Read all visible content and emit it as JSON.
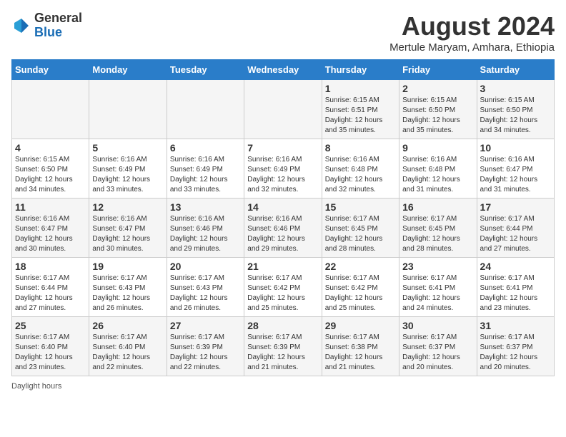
{
  "header": {
    "logo_general": "General",
    "logo_blue": "Blue",
    "month_year": "August 2024",
    "location": "Mertule Maryam, Amhara, Ethiopia"
  },
  "days_of_week": [
    "Sunday",
    "Monday",
    "Tuesday",
    "Wednesday",
    "Thursday",
    "Friday",
    "Saturday"
  ],
  "weeks": [
    [
      {
        "day": "",
        "info": ""
      },
      {
        "day": "",
        "info": ""
      },
      {
        "day": "",
        "info": ""
      },
      {
        "day": "",
        "info": ""
      },
      {
        "day": "1",
        "info": "Sunrise: 6:15 AM\nSunset: 6:51 PM\nDaylight: 12 hours\nand 35 minutes."
      },
      {
        "day": "2",
        "info": "Sunrise: 6:15 AM\nSunset: 6:50 PM\nDaylight: 12 hours\nand 35 minutes."
      },
      {
        "day": "3",
        "info": "Sunrise: 6:15 AM\nSunset: 6:50 PM\nDaylight: 12 hours\nand 34 minutes."
      }
    ],
    [
      {
        "day": "4",
        "info": "Sunrise: 6:15 AM\nSunset: 6:50 PM\nDaylight: 12 hours\nand 34 minutes."
      },
      {
        "day": "5",
        "info": "Sunrise: 6:16 AM\nSunset: 6:49 PM\nDaylight: 12 hours\nand 33 minutes."
      },
      {
        "day": "6",
        "info": "Sunrise: 6:16 AM\nSunset: 6:49 PM\nDaylight: 12 hours\nand 33 minutes."
      },
      {
        "day": "7",
        "info": "Sunrise: 6:16 AM\nSunset: 6:49 PM\nDaylight: 12 hours\nand 32 minutes."
      },
      {
        "day": "8",
        "info": "Sunrise: 6:16 AM\nSunset: 6:48 PM\nDaylight: 12 hours\nand 32 minutes."
      },
      {
        "day": "9",
        "info": "Sunrise: 6:16 AM\nSunset: 6:48 PM\nDaylight: 12 hours\nand 31 minutes."
      },
      {
        "day": "10",
        "info": "Sunrise: 6:16 AM\nSunset: 6:47 PM\nDaylight: 12 hours\nand 31 minutes."
      }
    ],
    [
      {
        "day": "11",
        "info": "Sunrise: 6:16 AM\nSunset: 6:47 PM\nDaylight: 12 hours\nand 30 minutes."
      },
      {
        "day": "12",
        "info": "Sunrise: 6:16 AM\nSunset: 6:47 PM\nDaylight: 12 hours\nand 30 minutes."
      },
      {
        "day": "13",
        "info": "Sunrise: 6:16 AM\nSunset: 6:46 PM\nDaylight: 12 hours\nand 29 minutes."
      },
      {
        "day": "14",
        "info": "Sunrise: 6:16 AM\nSunset: 6:46 PM\nDaylight: 12 hours\nand 29 minutes."
      },
      {
        "day": "15",
        "info": "Sunrise: 6:17 AM\nSunset: 6:45 PM\nDaylight: 12 hours\nand 28 minutes."
      },
      {
        "day": "16",
        "info": "Sunrise: 6:17 AM\nSunset: 6:45 PM\nDaylight: 12 hours\nand 28 minutes."
      },
      {
        "day": "17",
        "info": "Sunrise: 6:17 AM\nSunset: 6:44 PM\nDaylight: 12 hours\nand 27 minutes."
      }
    ],
    [
      {
        "day": "18",
        "info": "Sunrise: 6:17 AM\nSunset: 6:44 PM\nDaylight: 12 hours\nand 27 minutes."
      },
      {
        "day": "19",
        "info": "Sunrise: 6:17 AM\nSunset: 6:43 PM\nDaylight: 12 hours\nand 26 minutes."
      },
      {
        "day": "20",
        "info": "Sunrise: 6:17 AM\nSunset: 6:43 PM\nDaylight: 12 hours\nand 26 minutes."
      },
      {
        "day": "21",
        "info": "Sunrise: 6:17 AM\nSunset: 6:42 PM\nDaylight: 12 hours\nand 25 minutes."
      },
      {
        "day": "22",
        "info": "Sunrise: 6:17 AM\nSunset: 6:42 PM\nDaylight: 12 hours\nand 25 minutes."
      },
      {
        "day": "23",
        "info": "Sunrise: 6:17 AM\nSunset: 6:41 PM\nDaylight: 12 hours\nand 24 minutes."
      },
      {
        "day": "24",
        "info": "Sunrise: 6:17 AM\nSunset: 6:41 PM\nDaylight: 12 hours\nand 23 minutes."
      }
    ],
    [
      {
        "day": "25",
        "info": "Sunrise: 6:17 AM\nSunset: 6:40 PM\nDaylight: 12 hours\nand 23 minutes."
      },
      {
        "day": "26",
        "info": "Sunrise: 6:17 AM\nSunset: 6:40 PM\nDaylight: 12 hours\nand 22 minutes."
      },
      {
        "day": "27",
        "info": "Sunrise: 6:17 AM\nSunset: 6:39 PM\nDaylight: 12 hours\nand 22 minutes."
      },
      {
        "day": "28",
        "info": "Sunrise: 6:17 AM\nSunset: 6:39 PM\nDaylight: 12 hours\nand 21 minutes."
      },
      {
        "day": "29",
        "info": "Sunrise: 6:17 AM\nSunset: 6:38 PM\nDaylight: 12 hours\nand 21 minutes."
      },
      {
        "day": "30",
        "info": "Sunrise: 6:17 AM\nSunset: 6:37 PM\nDaylight: 12 hours\nand 20 minutes."
      },
      {
        "day": "31",
        "info": "Sunrise: 6:17 AM\nSunset: 6:37 PM\nDaylight: 12 hours\nand 20 minutes."
      }
    ]
  ],
  "footer": {
    "note": "Daylight hours"
  }
}
